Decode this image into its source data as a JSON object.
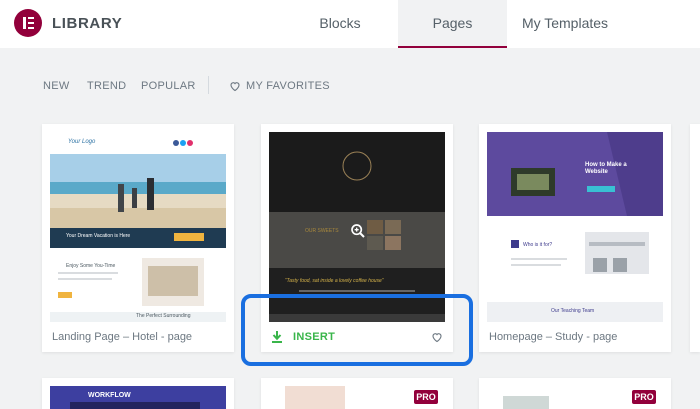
{
  "header": {
    "title": "LIBRARY",
    "tabs": [
      {
        "label": "Blocks",
        "active": false
      },
      {
        "label": "Pages",
        "active": true
      },
      {
        "label": "My Templates",
        "active": false
      }
    ]
  },
  "filters": {
    "items": [
      "NEW",
      "TREND",
      "POPULAR"
    ],
    "favorites": "MY FAVORITES"
  },
  "cards": [
    {
      "name": "Landing Page – Hotel - page",
      "thumb": {
        "logo": "Your Logo",
        "hero_caption": "Your Dream Vacation is Here",
        "section_title": "Enjoy Some You-Time",
        "section_title_2": "The Perfect Surrounding"
      }
    },
    {
      "name": "",
      "insert_label": "INSERT",
      "thumb": {
        "section_title": "OUR SWEETS",
        "quote": "“Tasty food, sat inside a lovely coffee house”"
      }
    },
    {
      "name": "Homepage – Study - page",
      "thumb": {
        "hero_title": "How to Make a Website",
        "section_title": "Who is it for?",
        "section_title_2": "Our Teaching Team"
      }
    }
  ],
  "bottom_cards": {
    "workflow_label": "WORKFLOW",
    "pro_badge": "PRO"
  },
  "colors": {
    "brand": "#92003b",
    "insert_green": "#39b54a",
    "highlight_blue": "#1a6fe0"
  }
}
